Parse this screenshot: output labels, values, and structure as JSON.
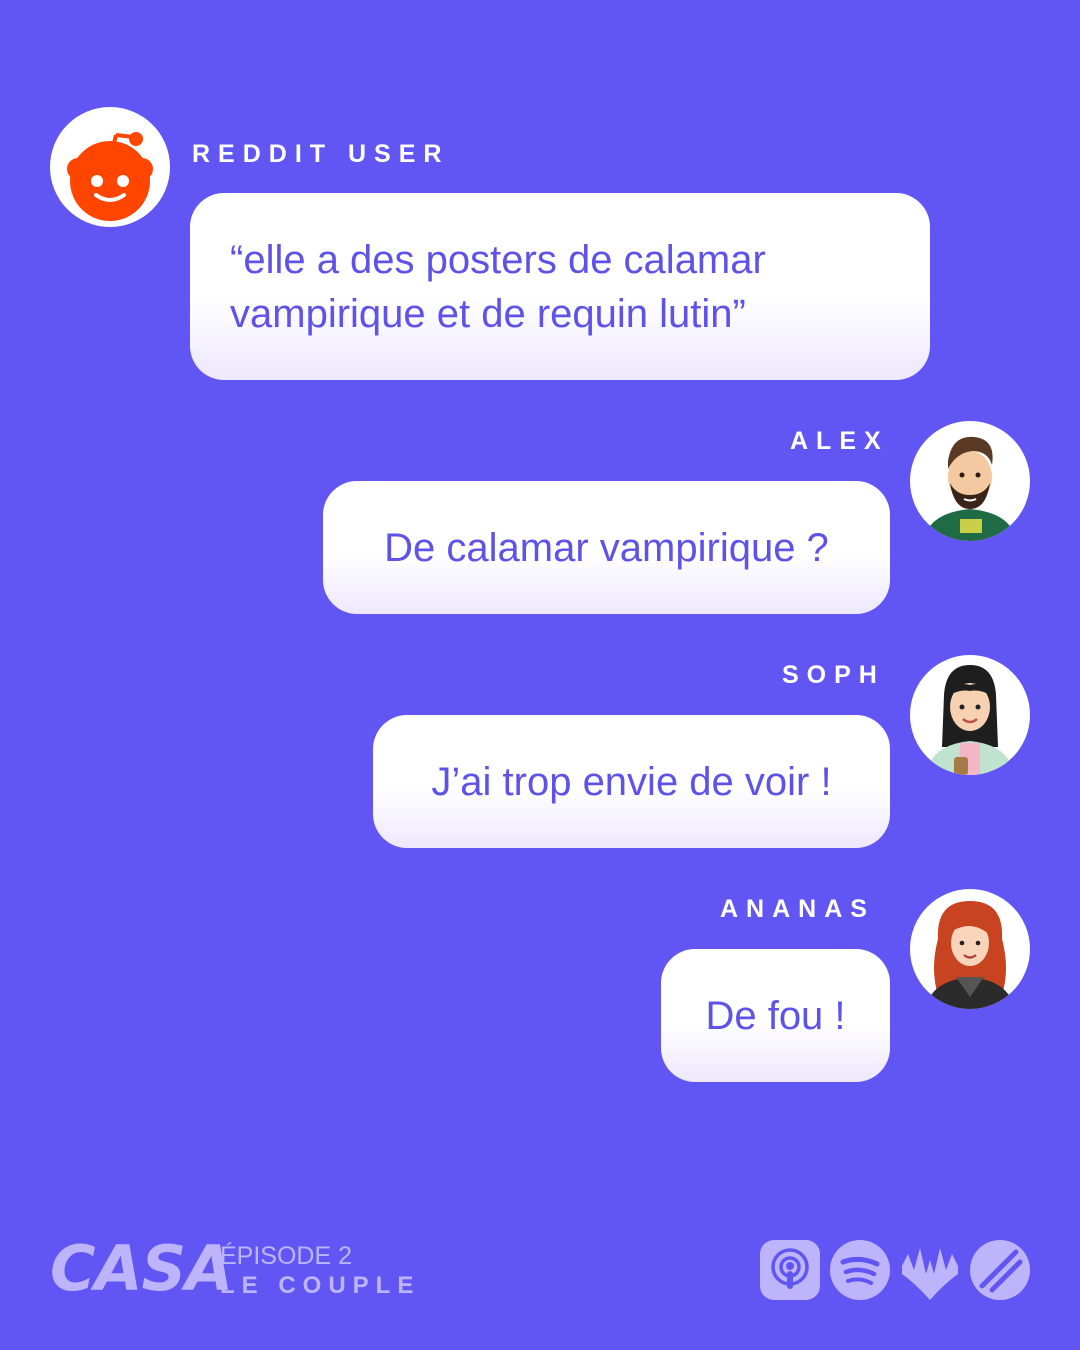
{
  "messages": [
    {
      "speaker": "REDDIT USER",
      "text_line1": "“elle a des posters de calamar",
      "text_line2": "vampirique et de requin lutin”"
    },
    {
      "speaker": "ALEX",
      "text": "De calamar vampirique ?"
    },
    {
      "speaker": "SOPH",
      "text": "J’ai trop envie de voir !"
    },
    {
      "speaker": "ANANAS",
      "text": "De fou !"
    }
  ],
  "footer": {
    "logo": "CASA",
    "episode": "ÉPISODE 2",
    "episode_title": "LE COUPLE",
    "platform_icons": [
      "apple-podcasts-icon",
      "spotify-icon",
      "deezer-icon",
      "podcast-addict-icon"
    ]
  },
  "colors": {
    "background": "#6156F4",
    "bubble_text": "#5E52E8",
    "footer_accent": "#BDB4FB",
    "reddit_orange": "#FF4500"
  }
}
